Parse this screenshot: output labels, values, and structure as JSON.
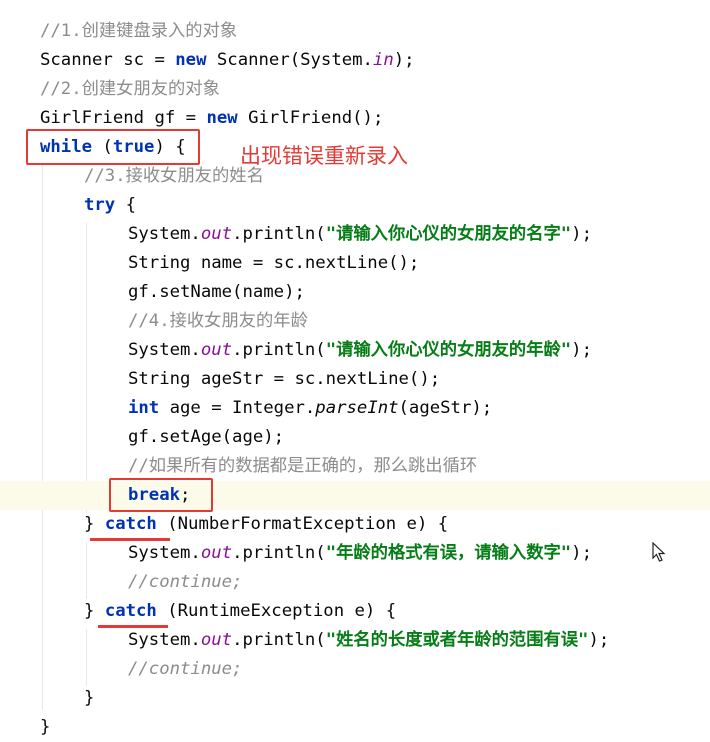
{
  "code": {
    "c1": "//1.创建键盘录入的对象",
    "l2a": "Scanner sc = ",
    "l2kw": "new",
    "l2b": " Scanner(System.",
    "l2fld": "in",
    "l2c": ");",
    "c3": "//2.创建女朋友的对象",
    "l4a": "GirlFriend gf = ",
    "l4kw": "new",
    "l4b": " GirlFriend();",
    "l5kw1": "while",
    "l5a": " (",
    "l5kw2": "true",
    "l5b": ") {",
    "c6": "//3.接收女朋友的姓名",
    "l7kw": "try",
    "l7a": " {",
    "l8a": "System.",
    "l8fld": "out",
    "l8b": ".println(",
    "l8st": "\"请输入你心仪的女朋友的名字\"",
    "l8c": ");",
    "l9": "String name = sc.nextLine();",
    "l10": "gf.setName(name);",
    "c11": "//4.接收女朋友的年龄",
    "l12a": "System.",
    "l12fld": "out",
    "l12b": ".println(",
    "l12st": "\"请输入你心仪的女朋友的年龄\"",
    "l12c": ");",
    "l13": "String ageStr = sc.nextLine();",
    "l14kw": "int",
    "l14a": " age = Integer.",
    "l14m": "parseInt",
    "l14b": "(ageStr);",
    "l15": "gf.setAge(age);",
    "c16": "//如果所有的数据都是正确的，那么跳出循环",
    "l17kw": "break",
    "l17a": ";",
    "l18a": "} ",
    "l18kw": "catch",
    "l18b": " (NumberFormatException e) {",
    "l19a": "System.",
    "l19fld": "out",
    "l19b": ".println(",
    "l19st": "\"年龄的格式有误，请输入数字\"",
    "l19c": ");",
    "c20": "//continue;",
    "l21a": "} ",
    "l21kw": "catch",
    "l21b": " (RuntimeException e) {",
    "l22a": "System.",
    "l22fld": "out",
    "l22b": ".println(",
    "l22st": "\"姓名的长度或者年龄的范围有误\"",
    "l22c": ");",
    "c23": "//continue;",
    "l24": "}",
    "l25": "}"
  },
  "annotation": {
    "text": "出现错误重新录入"
  },
  "colors": {
    "keyword": "#0033b3",
    "string": "#067d17",
    "comment": "#8c8c8c",
    "field": "#871094",
    "markup": "#e53935"
  }
}
